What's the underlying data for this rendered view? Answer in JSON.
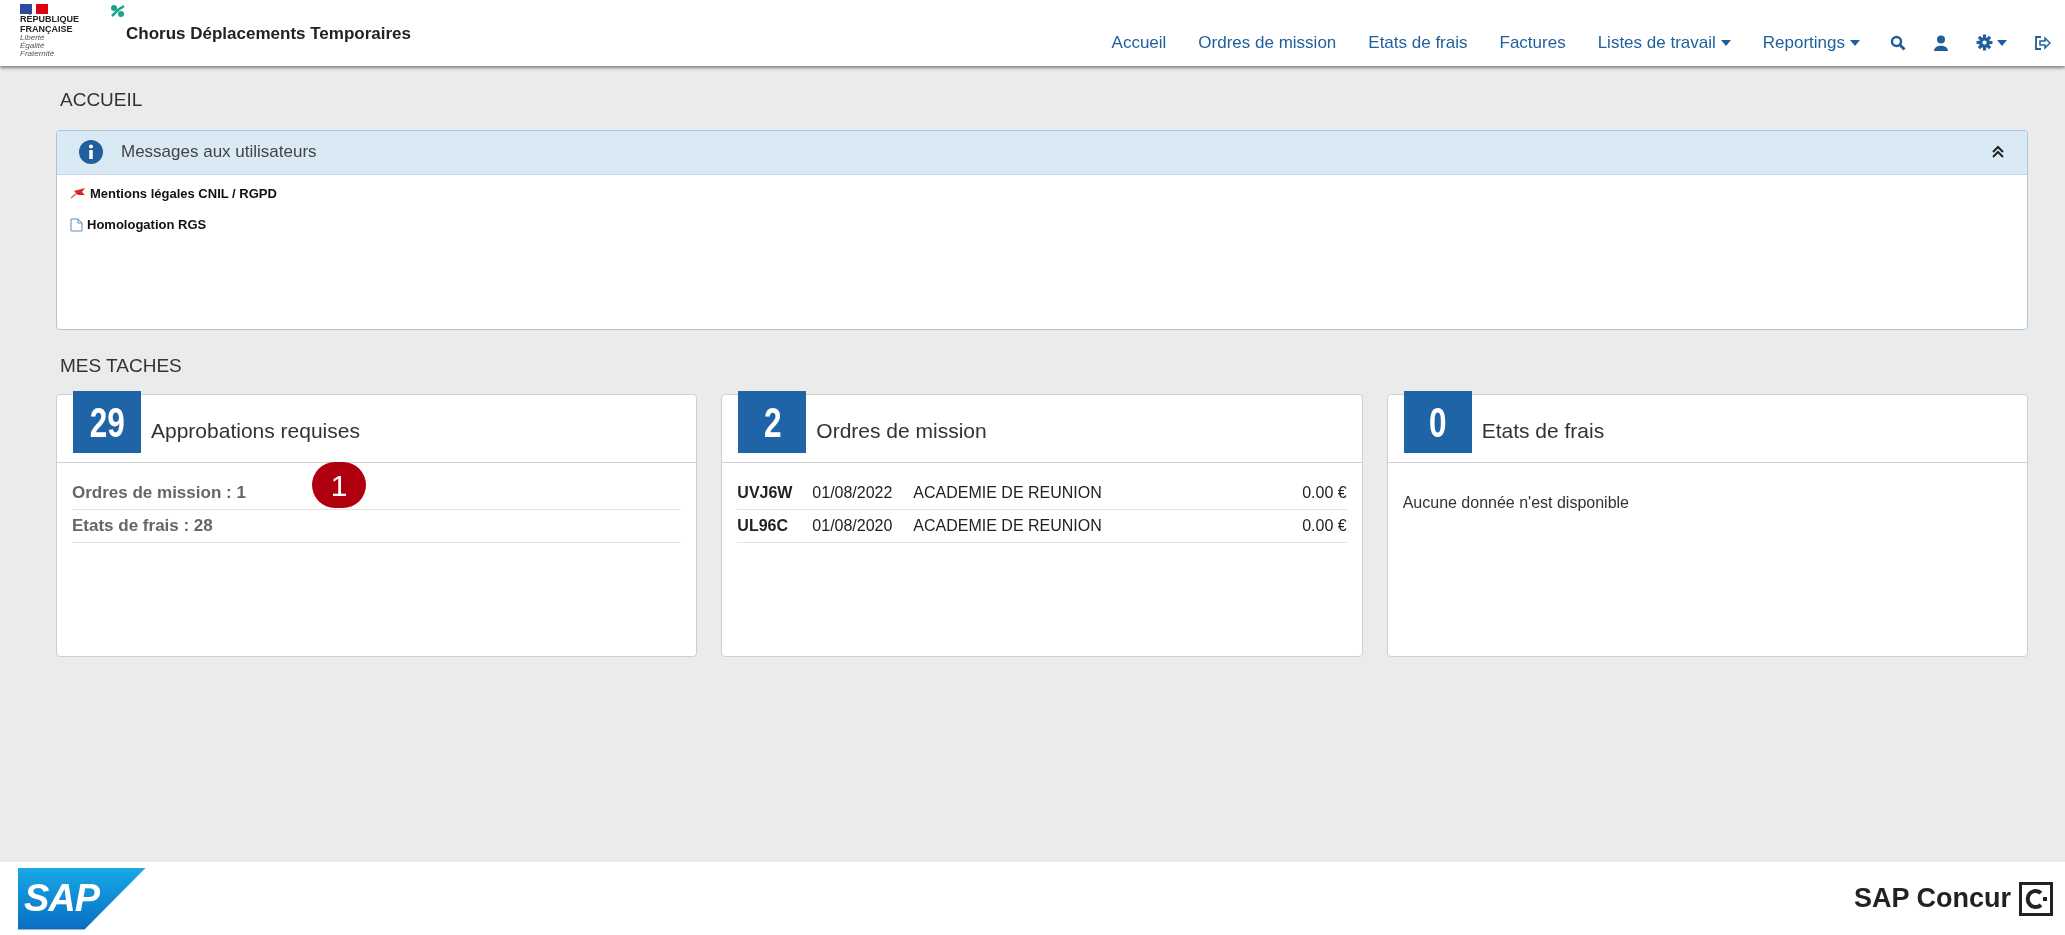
{
  "header": {
    "logo_lines": [
      "RÉPUBLIQUE",
      "FRANÇAISE"
    ],
    "motto": [
      "Liberté",
      "Égalité",
      "Fraternité"
    ],
    "app_title": "Chorus Déplacements Temporaires",
    "nav": [
      {
        "kind": "link",
        "label": "Accueil"
      },
      {
        "kind": "link",
        "label": "Ordres de mission"
      },
      {
        "kind": "link",
        "label": "Etats de frais"
      },
      {
        "kind": "link",
        "label": "Factures"
      },
      {
        "kind": "dropdown",
        "label": "Listes de travail"
      },
      {
        "kind": "dropdown",
        "label": "Reportings"
      },
      {
        "kind": "search"
      },
      {
        "kind": "user"
      },
      {
        "kind": "settings"
      },
      {
        "kind": "logout"
      }
    ]
  },
  "page_title": "ACCUEIL",
  "messages": {
    "title": "Messages aux utilisateurs",
    "expanded": true,
    "items": [
      {
        "kind": "pin",
        "label": "Mentions légales CNIL / RGPD"
      },
      {
        "kind": "document",
        "label": "Homologation RGS"
      }
    ]
  },
  "tasks_title": "MES TACHES",
  "cards": [
    {
      "count": "29",
      "title": "Approbations requises",
      "kind": "summary",
      "lines": [
        "Ordres de mission : 1",
        "Etats de frais : 28"
      ]
    },
    {
      "count": "2",
      "title": "Ordres de mission",
      "kind": "table",
      "rows": [
        {
          "code": "UVJ6W",
          "date": "01/08/2022",
          "label": "ACADEMIE DE REUNION",
          "amount": "0.00 €"
        },
        {
          "code": "UL96C",
          "date": "01/08/2020",
          "label": "ACADEMIE DE REUNION",
          "amount": "0.00 €"
        }
      ]
    },
    {
      "count": "0",
      "title": "Etats de frais",
      "kind": "empty",
      "message": "Aucune donnée n'est disponible"
    }
  ],
  "annotation": "1",
  "footer": {
    "left_logo": "SAP",
    "right_brand": "SAP Concur"
  }
}
